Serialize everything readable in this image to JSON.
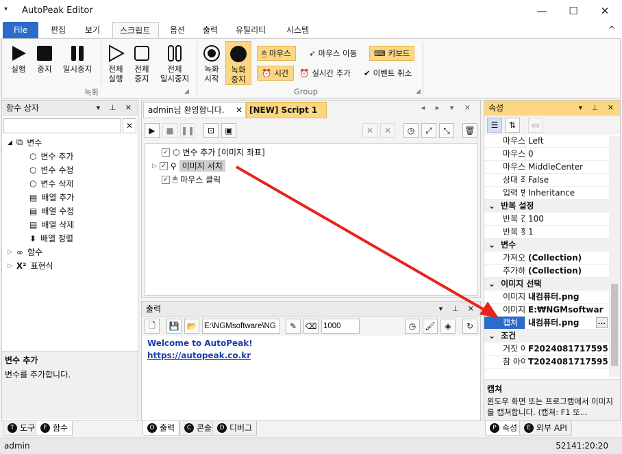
{
  "window": {
    "title": "AutoPeak Editor",
    "minimize": "—",
    "maximize": "☐",
    "close": "✕",
    "menu_glyph": "▾"
  },
  "ribbon_tabs": [
    "File",
    "편집",
    "보기",
    "스크립트",
    "옵션",
    "출력",
    "유틸리티",
    "시스템"
  ],
  "ribbon": {
    "record": {
      "rec": "실행",
      "stop": "중지",
      "pause": "일시중지"
    },
    "all": {
      "run": [
        "전체",
        "실행"
      ],
      "stop": [
        "전체",
        "중지"
      ],
      "pause": [
        "전체",
        "일시중지"
      ]
    },
    "group_record": "녹화",
    "rec_start": [
      "녹화",
      "시작"
    ],
    "rec_stop": [
      "녹화",
      "중지"
    ],
    "group_group": "Group",
    "mouse": "마우스",
    "mouse_move": "마우스 이동",
    "keyboard": "키보드",
    "time": "시간",
    "realtime": "실시간 추가",
    "event_cancel": "이벤트 취소",
    "collapse": "^"
  },
  "left_panel": {
    "title": "함수 상자",
    "search_placeholder": "",
    "tree": {
      "vars": "변수",
      "items": [
        "변수 추가",
        "변수 수정",
        "변수 삭제",
        "배열 추가",
        "배열 수정",
        "배열 삭제",
        "배열 정렬"
      ],
      "func": "함수",
      "expr": "표현식"
    },
    "desc_title": "변수 추가",
    "desc_text": "변수를 추가합니다.",
    "tabs": [
      {
        "letter": "T",
        "label": "도구"
      },
      {
        "letter": "F",
        "label": "함수"
      }
    ]
  },
  "doc_tabs": [
    "admin님 환영합니다.",
    "[NEW] Script 1"
  ],
  "script_lines": [
    {
      "label": "변수 추가 [이미지 좌표]"
    },
    {
      "label": "이미지 서치"
    },
    {
      "label": "마우스 클릭"
    }
  ],
  "output": {
    "title": "출력",
    "path": "E:\\NGMsoftware\\NG",
    "number": "1000",
    "welcome": "Welcome to AutoPeak!",
    "link": "https://autopeak.co.kr",
    "tabs": [
      {
        "letter": "O",
        "label": "출력"
      },
      {
        "letter": "C",
        "label": "콘솔"
      },
      {
        "letter": "D",
        "label": "디버그"
      }
    ]
  },
  "properties": {
    "title": "속성",
    "rows": [
      {
        "type": "prop",
        "k": "마우스 버",
        "v": "Left"
      },
      {
        "type": "prop",
        "k": "마우스 실",
        "v": "0"
      },
      {
        "type": "prop",
        "k": "마우스 위",
        "v": "MiddleCenter"
      },
      {
        "type": "prop",
        "k": "상대 좌표",
        "v": "False"
      },
      {
        "type": "prop",
        "k": "입력 방식",
        "v": "Inheritance"
      },
      {
        "type": "cat",
        "k": "반복 설정"
      },
      {
        "type": "prop",
        "k": "반복 간격",
        "v": "100"
      },
      {
        "type": "prop",
        "k": "반복 횟수",
        "v": "1"
      },
      {
        "type": "cat",
        "k": "변수"
      },
      {
        "type": "prop",
        "k": "가져오기",
        "v": "(Collection)",
        "bold": true
      },
      {
        "type": "prop",
        "k": "추가하기",
        "v": "(Collection)",
        "bold": true
      },
      {
        "type": "cat",
        "k": "이미지 선택"
      },
      {
        "type": "prop",
        "k": "이미지 선",
        "v": "내컴퓨터.png",
        "bold": true
      },
      {
        "type": "prop",
        "k": "이미지 파",
        "v": "E:₩NGMsoftwar",
        "bold": true
      },
      {
        "type": "prop",
        "k": "캡쳐",
        "v": "내컴퓨터.png",
        "bold": true,
        "selected": true
      },
      {
        "type": "cat",
        "k": "조건"
      },
      {
        "type": "prop",
        "k": "거짓 아이",
        "v": "F2024081717595",
        "bold": true
      },
      {
        "type": "prop",
        "k": "참 아이디",
        "v": "T2024081717595",
        "bold": true
      }
    ],
    "desc_title": "캡쳐",
    "desc_text": "윈도우 화면 또는 프로그램에서 이미지를 캡쳐합니다. (캡쳐: F1 또...",
    "tabs": [
      {
        "letter": "P",
        "label": "속성"
      },
      {
        "letter": "E",
        "label": "외부 API"
      }
    ]
  },
  "status": {
    "user": "admin",
    "time": "52141:20:20"
  },
  "colors": {
    "accent": "#2b6bc9",
    "highlight": "#fbd784",
    "arrow": "#e8231a"
  }
}
